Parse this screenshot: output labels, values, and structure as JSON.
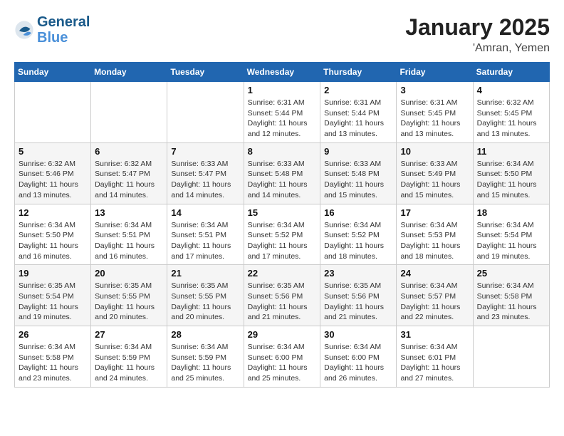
{
  "header": {
    "logo_line1": "General",
    "logo_line2": "Blue",
    "month": "January 2025",
    "location": "'Amran, Yemen"
  },
  "weekdays": [
    "Sunday",
    "Monday",
    "Tuesday",
    "Wednesday",
    "Thursday",
    "Friday",
    "Saturday"
  ],
  "weeks": [
    [
      {
        "day": "",
        "info": ""
      },
      {
        "day": "",
        "info": ""
      },
      {
        "day": "",
        "info": ""
      },
      {
        "day": "1",
        "info": "Sunrise: 6:31 AM\nSunset: 5:44 PM\nDaylight: 11 hours\nand 12 minutes."
      },
      {
        "day": "2",
        "info": "Sunrise: 6:31 AM\nSunset: 5:44 PM\nDaylight: 11 hours\nand 13 minutes."
      },
      {
        "day": "3",
        "info": "Sunrise: 6:31 AM\nSunset: 5:45 PM\nDaylight: 11 hours\nand 13 minutes."
      },
      {
        "day": "4",
        "info": "Sunrise: 6:32 AM\nSunset: 5:45 PM\nDaylight: 11 hours\nand 13 minutes."
      }
    ],
    [
      {
        "day": "5",
        "info": "Sunrise: 6:32 AM\nSunset: 5:46 PM\nDaylight: 11 hours\nand 13 minutes."
      },
      {
        "day": "6",
        "info": "Sunrise: 6:32 AM\nSunset: 5:47 PM\nDaylight: 11 hours\nand 14 minutes."
      },
      {
        "day": "7",
        "info": "Sunrise: 6:33 AM\nSunset: 5:47 PM\nDaylight: 11 hours\nand 14 minutes."
      },
      {
        "day": "8",
        "info": "Sunrise: 6:33 AM\nSunset: 5:48 PM\nDaylight: 11 hours\nand 14 minutes."
      },
      {
        "day": "9",
        "info": "Sunrise: 6:33 AM\nSunset: 5:48 PM\nDaylight: 11 hours\nand 15 minutes."
      },
      {
        "day": "10",
        "info": "Sunrise: 6:33 AM\nSunset: 5:49 PM\nDaylight: 11 hours\nand 15 minutes."
      },
      {
        "day": "11",
        "info": "Sunrise: 6:34 AM\nSunset: 5:50 PM\nDaylight: 11 hours\nand 15 minutes."
      }
    ],
    [
      {
        "day": "12",
        "info": "Sunrise: 6:34 AM\nSunset: 5:50 PM\nDaylight: 11 hours\nand 16 minutes."
      },
      {
        "day": "13",
        "info": "Sunrise: 6:34 AM\nSunset: 5:51 PM\nDaylight: 11 hours\nand 16 minutes."
      },
      {
        "day": "14",
        "info": "Sunrise: 6:34 AM\nSunset: 5:51 PM\nDaylight: 11 hours\nand 17 minutes."
      },
      {
        "day": "15",
        "info": "Sunrise: 6:34 AM\nSunset: 5:52 PM\nDaylight: 11 hours\nand 17 minutes."
      },
      {
        "day": "16",
        "info": "Sunrise: 6:34 AM\nSunset: 5:52 PM\nDaylight: 11 hours\nand 18 minutes."
      },
      {
        "day": "17",
        "info": "Sunrise: 6:34 AM\nSunset: 5:53 PM\nDaylight: 11 hours\nand 18 minutes."
      },
      {
        "day": "18",
        "info": "Sunrise: 6:34 AM\nSunset: 5:54 PM\nDaylight: 11 hours\nand 19 minutes."
      }
    ],
    [
      {
        "day": "19",
        "info": "Sunrise: 6:35 AM\nSunset: 5:54 PM\nDaylight: 11 hours\nand 19 minutes."
      },
      {
        "day": "20",
        "info": "Sunrise: 6:35 AM\nSunset: 5:55 PM\nDaylight: 11 hours\nand 20 minutes."
      },
      {
        "day": "21",
        "info": "Sunrise: 6:35 AM\nSunset: 5:55 PM\nDaylight: 11 hours\nand 20 minutes."
      },
      {
        "day": "22",
        "info": "Sunrise: 6:35 AM\nSunset: 5:56 PM\nDaylight: 11 hours\nand 21 minutes."
      },
      {
        "day": "23",
        "info": "Sunrise: 6:35 AM\nSunset: 5:56 PM\nDaylight: 11 hours\nand 21 minutes."
      },
      {
        "day": "24",
        "info": "Sunrise: 6:34 AM\nSunset: 5:57 PM\nDaylight: 11 hours\nand 22 minutes."
      },
      {
        "day": "25",
        "info": "Sunrise: 6:34 AM\nSunset: 5:58 PM\nDaylight: 11 hours\nand 23 minutes."
      }
    ],
    [
      {
        "day": "26",
        "info": "Sunrise: 6:34 AM\nSunset: 5:58 PM\nDaylight: 11 hours\nand 23 minutes."
      },
      {
        "day": "27",
        "info": "Sunrise: 6:34 AM\nSunset: 5:59 PM\nDaylight: 11 hours\nand 24 minutes."
      },
      {
        "day": "28",
        "info": "Sunrise: 6:34 AM\nSunset: 5:59 PM\nDaylight: 11 hours\nand 25 minutes."
      },
      {
        "day": "29",
        "info": "Sunrise: 6:34 AM\nSunset: 6:00 PM\nDaylight: 11 hours\nand 25 minutes."
      },
      {
        "day": "30",
        "info": "Sunrise: 6:34 AM\nSunset: 6:00 PM\nDaylight: 11 hours\nand 26 minutes."
      },
      {
        "day": "31",
        "info": "Sunrise: 6:34 AM\nSunset: 6:01 PM\nDaylight: 11 hours\nand 27 minutes."
      },
      {
        "day": "",
        "info": ""
      }
    ]
  ]
}
